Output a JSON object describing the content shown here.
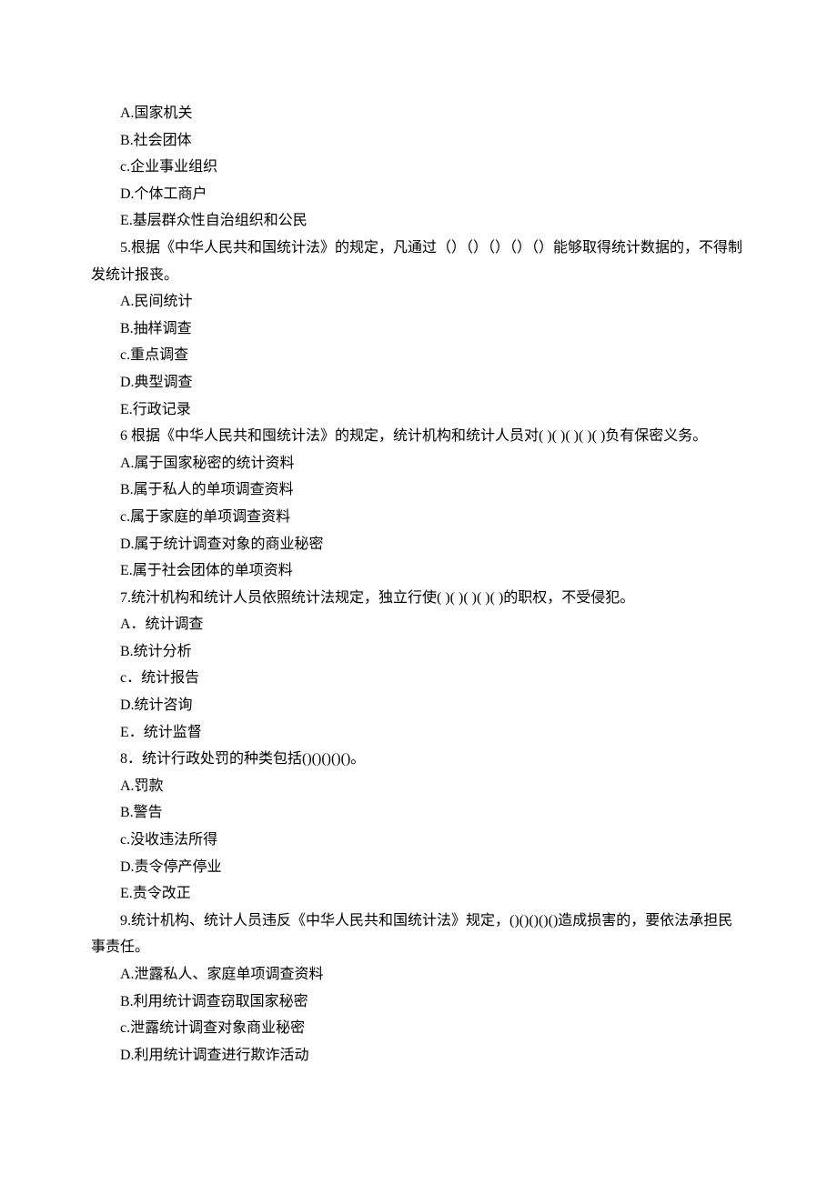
{
  "q4": {
    "options": {
      "A": "A.国家机关",
      "B": "B.社会团体",
      "C": "c.企业事业组织",
      "D": "D.个体工商户",
      "E": "E.基层群众性自治组织和公民"
    }
  },
  "q5": {
    "stem": "5.根据《中华人民共和国统计法》的规定，凡通过（）（）（）（）（）能够取得统计数据的，不得制发统计报丧。",
    "options": {
      "A": "A.民间统计",
      "B": "B.抽样调查",
      "C": "c.重点调查",
      "D": "D.典型调查",
      "E": "E.行政记录"
    }
  },
  "q6": {
    "stem": "6 根据《中华人民共和囤统计法》的规定，统计机构和统计人员对(  )(   )(  )(  )(  )负有保密义务。",
    "options": {
      "A": "A.属于国家秘密的统计资料",
      "B": "B.属于私人的单项调查资料",
      "C": "c.属于家庭的单项调查资料",
      "D": "D.属于统计调查对象的商业秘密",
      "E": "E.属于社会团体的单项资料"
    }
  },
  "q7": {
    "stem": "7.统汁机构和统计人员依照统计法规定，独立行使(  )(    )(  )(   )(   )的职权，不受侵犯。",
    "options": {
      "A": "A．统计调查",
      "B": "B.统计分析",
      "C": "c．统计报告",
      "D": "D.统计咨询",
      "E": "E．统计监督"
    }
  },
  "q8": {
    "stem": "8．统计行政处罚的种类包括()()()()()。",
    "options": {
      "A": "A.罚款",
      "B": "B.警告",
      "C": "c.没收违法所得",
      "D": "D.责令停产停业",
      "E": "E.责令改正"
    }
  },
  "q9": {
    "stem": "9.统计机构、统计人员违反《中华人民共和国统计法》规定，()()()()()造成损害的，要依法承担民事责任。",
    "options": {
      "A": "A.泄露私人、家庭单项调查资料",
      "B": "B.利用统计调查窃取国家秘密",
      "C": "c.泄露统计调查对象商业秘密",
      "D": "D.利用统计调查进行欺诈活动"
    }
  }
}
